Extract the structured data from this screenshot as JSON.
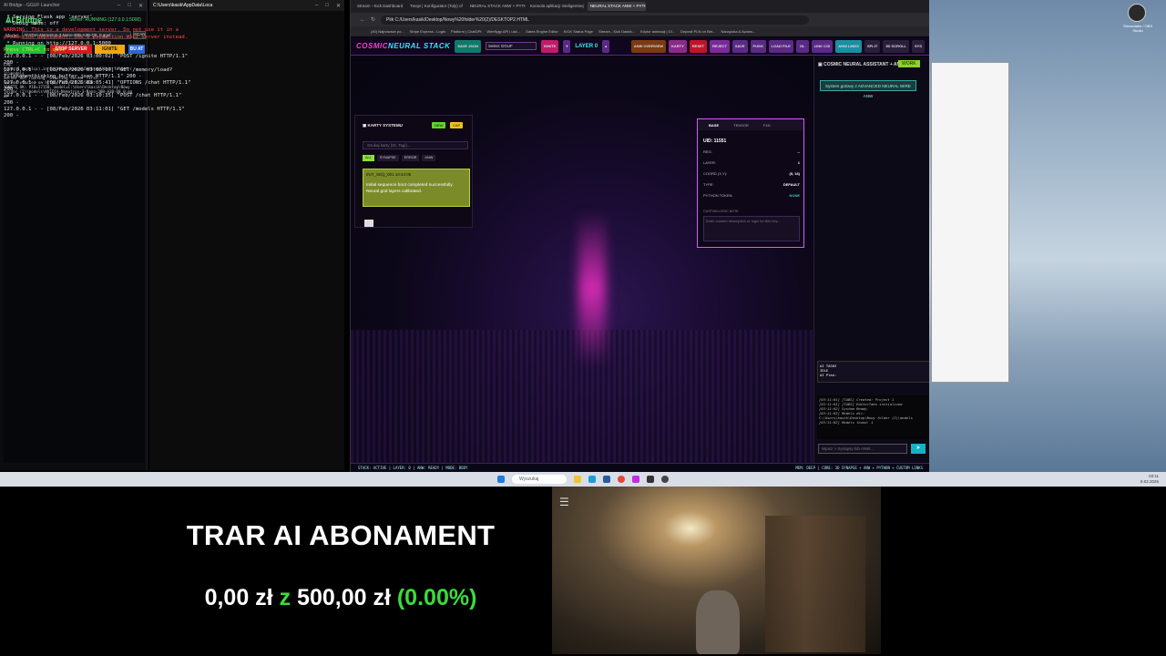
{
  "aibridge": {
    "window_title": "AI Bridge - GGUF Launcher",
    "title": "AI Bridge",
    "status": "Server: RUNNING (127.0.0.1:5000)",
    "model_label": "Model:",
    "model_value": "NVIDIA-Nemotron-3-Nano-30B-A3B-Q8_0.gguf",
    "scan": "SCAN",
    "btn_start": "START SERVER",
    "btn_stop": "STOP SERVER",
    "btn_ignite": "IGNITE",
    "btn_extra": "BU AT",
    "log": "Log:\nFound 1 model(s) in C:\\Users\\kasik\\Desktop\\Nowy folder (\n2)\\models\nServer not running. Starting server first...\nServer started on http://127.0.0.1:5000\nIGNITE OK: PID=17158, model=C:\\Users\\kasik\\Desktop\\Nowy\nfolder (2)\\models\\NVIDIA-Nemotron-3-Nano-30B-A3B-Q8_0.gg\nuf"
  },
  "terminal": {
    "tab_title": "C:\\Users\\kasik\\AppData\\Loca",
    "lines": [
      {
        "t": " * Serving Flask app 'server'",
        "c": "#e6e6e6"
      },
      {
        "t": " * Debug mode: off",
        "c": "#e6e6e6"
      },
      {
        "t": "WARNING: This is a development server. Do not use it in a production deployment. Use a production WSGI server instead.",
        "c": "#ff4a4a"
      },
      {
        "t": " * Running on http://127.0.0.1:5000",
        "c": "#e6e6e6"
      },
      {
        "t": "Press CTRL+C to quit",
        "c": "#e8d84a"
      },
      {
        "t": "127.0.0.1 - - [08/Feb/2026 03:00:02] \"POST /ignite HTTP/1.1\" 200 -",
        "c": "#e6e6e6"
      },
      {
        "t": "127.0.0.1 - - [08/Feb/2026 03:00:17] \"GET /memory/load?filename=thinking_buffer.json HTTP/1.1\" 200 -",
        "c": "#e6e6e6"
      },
      {
        "t": "127.0.0.1 - - [08/Feb/2026 03:05:41] \"OPTIONS /chat HTTP/1.1\" 200 -",
        "c": "#e6e6e6"
      },
      {
        "t": "127.0.0.1 - - [08/Feb/2026 03:10:35] \"POST /chat HTTP/1.1\" 200 -",
        "c": "#e6e6e6"
      },
      {
        "t": "127.0.0.1 - - [08/Feb/2026 03:11:01] \"GET /models HTTP/1.1\" 200 -",
        "c": "#e6e6e6"
      }
    ]
  },
  "browser": {
    "tabs": [
      "Stream - Kick Dashboard",
      "Twoje | Konfigurator (Tuly) of",
      "NEURAL STACK ANW + PYTHON",
      "Konsola aplikacji inteligentnej",
      "NEURAL STACK ANW + PYTHON"
    ],
    "url": "Plik  C:/Users/kasik/Desktop/Nowy%20folder%20(2)/DESKTOP2.HTML",
    "bookmarks": [
      "(40) Najnowsze po...",
      "Stripe Express - Login",
      "Platform | ChatGPt",
      "Weeflygy API i usk...",
      "Gates Engine Editor",
      "KICK Status Page",
      "Stream - Kick Dashb...",
      "Edytor animacji | Gi...",
      "Deposit PLN on Bet...",
      "Narzędzia & Awans..."
    ]
  },
  "neural": {
    "logo_a": "COSMIC",
    "logo_b": "NEURAL STACK",
    "btn_save": "SAVE JSON",
    "select": "Select GGUF",
    "btn_ignite": "IGNITE",
    "layer": "LAYER 0",
    "toolbar": [
      "ANW OVERVIEW",
      "KARTY",
      "RESET",
      "REJECT",
      "SAVE",
      "PUSH",
      "LOAD FILE",
      "GL",
      "LINK CGI",
      "ANW LINKS",
      "SPLIT",
      "3D SCROLL",
      "SYS"
    ],
    "cards": {
      "title": "KARTY SYSTEMU",
      "btn_new": "NEW",
      "btn_cap": "CAP",
      "search_placeholder": "Szukaj karty (ID, Tagi)...",
      "filters": [
        "ALL",
        "SYNAPSE",
        "ERROR",
        "ANW"
      ],
      "card_id": "INIT_SEQ_001 10:42:05",
      "card_text": "Initial sequence boot completed successfully. Neural grid layers calibrated."
    },
    "inspector": {
      "tabs": [
        "BASE",
        "TENSOR",
        "FXD"
      ],
      "uid": "UID: 11551",
      "rows": [
        {
          "k": "REG:",
          "v": "--"
        },
        {
          "k": "LAYER:",
          "v": "1"
        },
        {
          "k": "COORD (X,Y):",
          "v": "(5, 16)"
        },
        {
          "k": "TYPE:",
          "v": "DEFAULT"
        },
        {
          "k": "PYTHON TOKEN:",
          "v": "NONE"
        }
      ],
      "note_label": "CUSTOM LOGIC NOTE",
      "note_placeholder": "Enter custom description or logic for this key..."
    },
    "assistant": {
      "title": "COSMIC NEURAL ASSISTANT + ANW",
      "work": "WORK",
      "message": "System gotowy z ADVANCED NEURAL WIRE ANW",
      "tasks": "AI TASKS\nIDLE\nAI Plan:",
      "console": "[03:11:01] [TABS] Created: Project 1\n[03:11:01] [TABS] EditorTabs initialized\n[03:11:02] System Ready.\n[03:11:02] Models dir:\nC:\\Users\\kasik\\Desktop\\Nowy folder (2)\\models\n[03:11:02] Models found: 1",
      "input_placeholder": "Wpisz > Synapsy lub ANW...",
      "send": "➤"
    },
    "status_left": "STACK: ACTIVE | LAYER: 0 | ANW: READY | MODE: BODY",
    "status_right": "MEM: DEEP | CORE: 3D SYNAPSE + ANW + PYTHON + CUSTOM LINKS"
  },
  "desktop": {
    "icon_label": "Streamlabs / OBS Studio"
  },
  "taskbar": {
    "search": "Wyszukaj",
    "clock": "03:11\n8.02.2026"
  },
  "overlay": {
    "title": "TRAR AI ABONAMENT",
    "amount": "0,00 zł",
    "of": "z",
    "goal": "500,00 zł",
    "percent": "(0.00%)"
  }
}
